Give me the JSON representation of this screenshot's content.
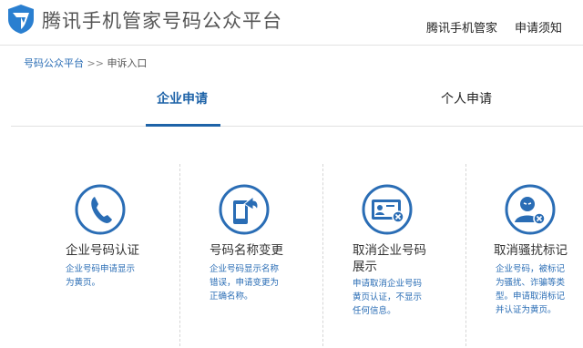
{
  "header": {
    "title": "腾讯手机管家号码公众平台",
    "nav": [
      "腾讯手机管家",
      "申请须知"
    ],
    "logo": "shield-logo"
  },
  "breadcrumb": {
    "root": "号码公众平台",
    "sep": ">>",
    "current": "申诉入口"
  },
  "tabs": [
    {
      "label": "企业申请",
      "active": true
    },
    {
      "label": "个人申请",
      "active": false
    }
  ],
  "services": [
    {
      "icon": "phone-icon",
      "title": "企业号码认证",
      "desc": [
        "企业号码申请显示",
        "为黄页。"
      ]
    },
    {
      "icon": "mobile-share-icon",
      "title": "号码名称变更",
      "desc": [
        "企业号码显示名称",
        "错误，申请变更为",
        "正确名称。"
      ]
    },
    {
      "icon": "id-card-remove-icon",
      "title": [
        "取消企业号码",
        "展示"
      ],
      "desc": [
        "申请取消企业号码",
        "黄页认证，不显示",
        "任何信息。"
      ]
    },
    {
      "icon": "user-remove-icon",
      "title": "取消骚扰标记",
      "desc": [
        "企业号码，被标记",
        "为骚扰、诈骗等类",
        "型。申请取消标记",
        "并认证为黄页。"
      ]
    }
  ],
  "colors": {
    "accent": "#1e63a8",
    "icon": "#2a6db5"
  }
}
